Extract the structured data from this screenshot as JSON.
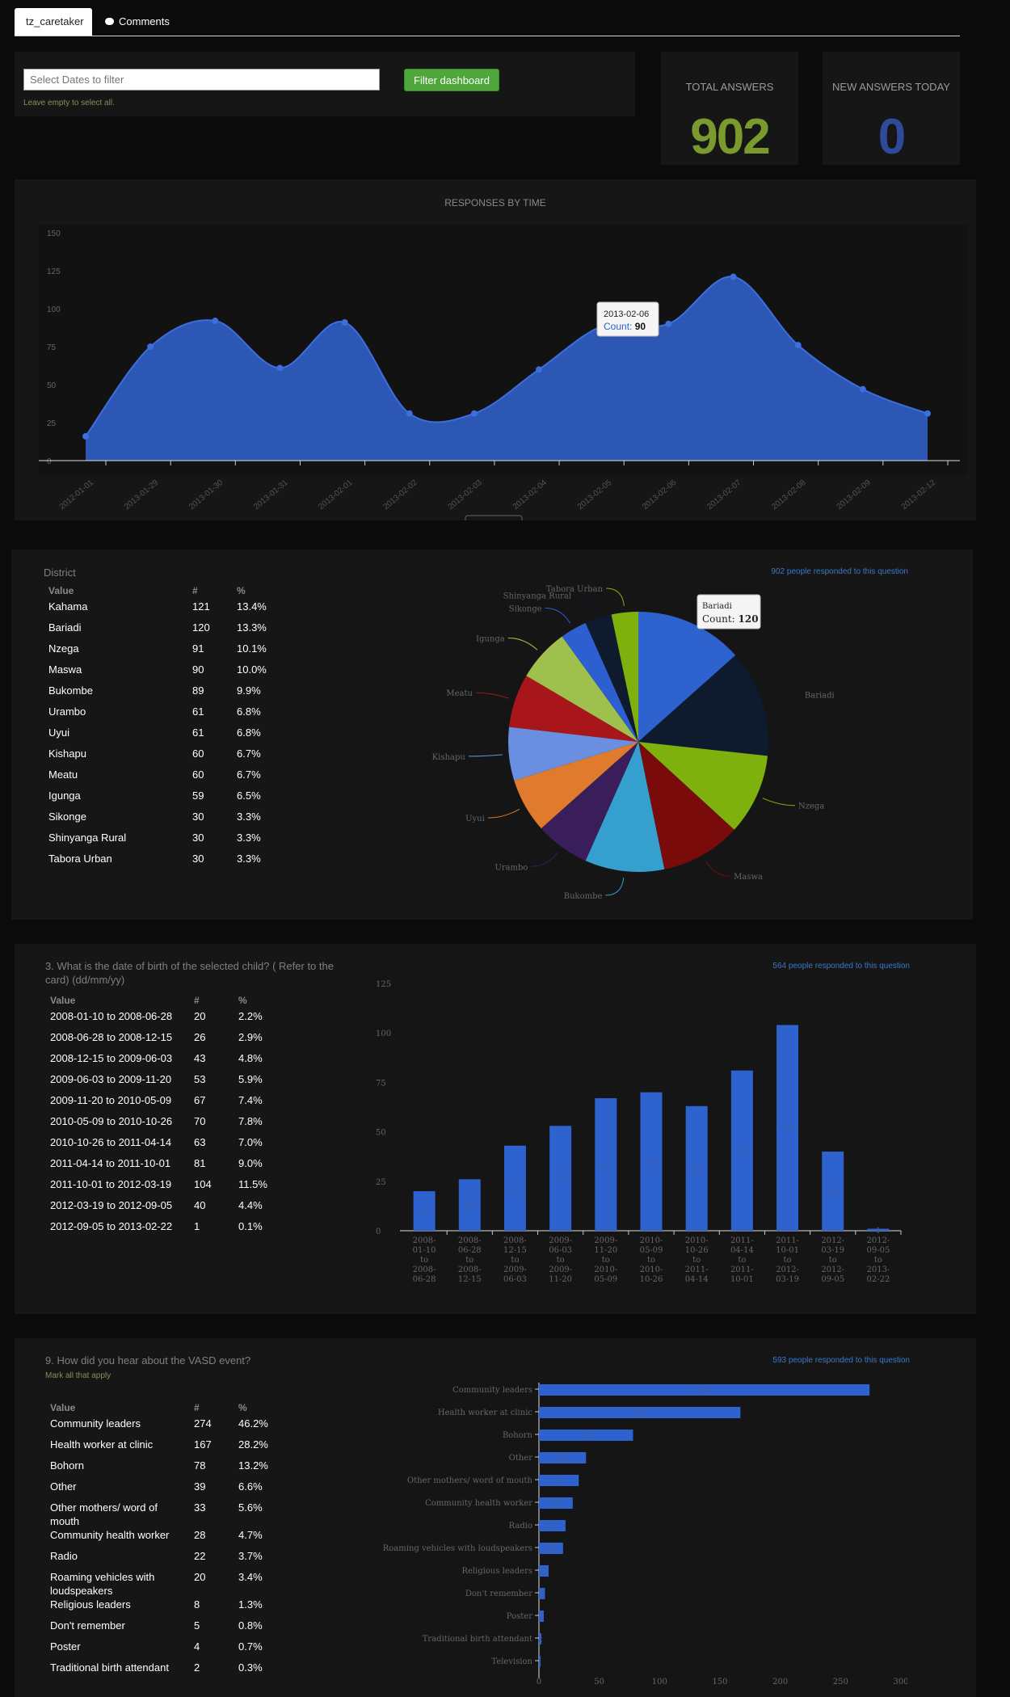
{
  "tabs": [
    {
      "label": "tz_caretaker",
      "active": true
    },
    {
      "label": "Comments",
      "active": false
    }
  ],
  "filter": {
    "placeholder": "Select Dates to filter",
    "button_label": "Filter dashboard",
    "hint": "Leave empty to select all."
  },
  "stats": [
    {
      "title": "TOTAL ANSWERS",
      "value": "902",
      "color": "#7a9a2e"
    },
    {
      "title": "NEW ANSWERS TODAY",
      "value": "0",
      "color": "#2e4a99"
    }
  ],
  "colors": {
    "accent_blue": "#2e62cf",
    "green": "#4fa63b"
  },
  "time_chart": {
    "title": "RESPONSES BY TIME",
    "tooltip": {
      "date": "2013-02-06",
      "label": "Count:",
      "value": "90"
    },
    "chart_data": {
      "type": "area",
      "x": [
        "2012-01-01",
        "2013-01-29",
        "2013-01-30",
        "2013-01-31",
        "2013-02-01",
        "2013-02-02",
        "2013-02-03",
        "2013-02-04",
        "2013-02-05",
        "2013-02-06",
        "2013-02-07",
        "2013-02-08",
        "2013-02-09",
        "2013-02-12"
      ],
      "values": [
        16,
        75,
        92,
        61,
        91,
        31,
        31,
        60,
        89,
        90,
        121,
        76,
        47,
        31
      ],
      "ylim": [
        0,
        150
      ],
      "yticks": [
        0,
        25,
        50,
        75,
        100,
        125,
        150
      ]
    }
  },
  "district": {
    "title": "District",
    "responded": "902 people responded to this question",
    "headers": [
      "Value",
      "#",
      "%"
    ],
    "rows": [
      [
        "Kahama",
        "121",
        "13.4%"
      ],
      [
        "Bariadi",
        "120",
        "13.3%"
      ],
      [
        "Nzega",
        "91",
        "10.1%"
      ],
      [
        "Maswa",
        "90",
        "10.0%"
      ],
      [
        "Bukombe",
        "89",
        "9.9%"
      ],
      [
        "Urambo",
        "61",
        "6.8%"
      ],
      [
        "Uyui",
        "61",
        "6.8%"
      ],
      [
        "Kishapu",
        "60",
        "6.7%"
      ],
      [
        "Meatu",
        "60",
        "6.7%"
      ],
      [
        "Igunga",
        "59",
        "6.5%"
      ],
      [
        "Sikonge",
        "30",
        "3.3%"
      ],
      [
        "Shinyanga Rural",
        "30",
        "3.3%"
      ],
      [
        "Tabora Urban",
        "30",
        "3.3%"
      ]
    ],
    "tooltip": {
      "name": "Bariadi",
      "label": "Count:",
      "value": "120"
    },
    "chart_data": {
      "type": "pie",
      "labels": [
        "Kahama",
        "Bariadi",
        "Nzega",
        "Maswa",
        "Bukombe",
        "Urambo",
        "Uyui",
        "Kishapu",
        "Meatu",
        "Igunga",
        "Sikonge",
        "Shinyanga Rural",
        "Tabora Urban"
      ],
      "values": [
        121,
        120,
        91,
        90,
        89,
        61,
        61,
        60,
        60,
        59,
        30,
        30,
        30
      ],
      "colors": [
        "#2e62cf",
        "#0e1a2e",
        "#7eb10d",
        "#7a0b0b",
        "#35a0cd",
        "#3a1e5c",
        "#e07a2c",
        "#6b8fe0",
        "#a8161c",
        "#9fc04d",
        "#2d5fd0",
        "#0f1a2f",
        "#7eb10d"
      ]
    }
  },
  "dob": {
    "title": "3. What is the date of birth of the selected child? ( Refer to the card) (dd/mm/yy)",
    "responded": "564 people responded to this question",
    "headers": [
      "Value",
      "#",
      "%"
    ],
    "rows": [
      [
        "2008-01-10 to 2008-06-28",
        "20",
        "2.2%"
      ],
      [
        "2008-06-28 to 2008-12-15",
        "26",
        "2.9%"
      ],
      [
        "2008-12-15 to 2009-06-03",
        "43",
        "4.8%"
      ],
      [
        "2009-06-03 to 2009-11-20",
        "53",
        "5.9%"
      ],
      [
        "2009-11-20 to 2010-05-09",
        "67",
        "7.4%"
      ],
      [
        "2010-05-09 to 2010-10-26",
        "70",
        "7.8%"
      ],
      [
        "2010-10-26 to 2011-04-14",
        "63",
        "7.0%"
      ],
      [
        "2011-04-14 to 2011-10-01",
        "81",
        "9.0%"
      ],
      [
        "2011-10-01 to 2012-03-19",
        "104",
        "11.5%"
      ],
      [
        "2012-03-19 to 2012-09-05",
        "40",
        "4.4%"
      ],
      [
        "2012-09-05 to 2013-02-22",
        "1",
        "0.1%"
      ]
    ],
    "chart_data": {
      "type": "bar",
      "categories": [
        [
          "2008-",
          "01-10",
          "to",
          "2008-",
          "06-28"
        ],
        [
          "2008-",
          "06-28",
          "to",
          "2008-",
          "12-15"
        ],
        [
          "2008-",
          "12-15",
          "to",
          "2009-",
          "06-03"
        ],
        [
          "2009-",
          "06-03",
          "to",
          "2009-",
          "11-20"
        ],
        [
          "2009-",
          "11-20",
          "to",
          "2010-",
          "05-09"
        ],
        [
          "2010-",
          "05-09",
          "to",
          "2010-",
          "10-26"
        ],
        [
          "2010-",
          "10-26",
          "to",
          "2011-",
          "04-14"
        ],
        [
          "2011-",
          "04-14",
          "to",
          "2011-",
          "10-01"
        ],
        [
          "2011-",
          "10-01",
          "to",
          "2012-",
          "03-19"
        ],
        [
          "2012-",
          "03-19",
          "to",
          "2012-",
          "09-05"
        ],
        [
          "2012-",
          "09-05",
          "to",
          "2013-",
          "02-22"
        ]
      ],
      "values": [
        20,
        26,
        43,
        53,
        67,
        70,
        63,
        81,
        104,
        40,
        1
      ],
      "ylim": [
        0,
        125
      ],
      "yticks": [
        0,
        25,
        50,
        75,
        100,
        125
      ]
    }
  },
  "hear": {
    "title": "9. How did you hear about the VASD event?",
    "subtitle": "Mark all that apply",
    "responded": "593 people responded to this question",
    "headers": [
      "Value",
      "#",
      "%"
    ],
    "rows": [
      [
        "Community leaders",
        "274",
        "46.2%"
      ],
      [
        "Health worker at clinic",
        "167",
        "28.2%"
      ],
      [
        "Bohorn",
        "78",
        "13.2%"
      ],
      [
        "Other",
        "39",
        "6.6%"
      ],
      [
        "Other mothers/ word of mouth",
        "33",
        "5.6%"
      ],
      [
        "Community health worker",
        "28",
        "4.7%"
      ],
      [
        "Radio",
        "22",
        "3.7%"
      ],
      [
        "Roaming vehicles with loudspeakers",
        "20",
        "3.4%"
      ],
      [
        "Religious leaders",
        "8",
        "1.3%"
      ],
      [
        "Don't remember",
        "5",
        "0.8%"
      ],
      [
        "Poster",
        "4",
        "0.7%"
      ],
      [
        "Traditional birth attendant",
        "2",
        "0.3%"
      ]
    ],
    "chart_data": {
      "type": "bar",
      "orientation": "horizontal",
      "categories": [
        "Community leaders",
        "Health worker at clinic",
        "Bohorn",
        "Other",
        "Other mothers/ word of mouth",
        "Community health worker",
        "Radio",
        "Roaming vehicles with loudspeakers",
        "Religious leaders",
        "Don't remember",
        "Poster",
        "Traditional birth attendant",
        "Television"
      ],
      "values": [
        274,
        167,
        78,
        39,
        33,
        28,
        22,
        20,
        8,
        5,
        4,
        2,
        1
      ],
      "xlim": [
        0,
        300
      ],
      "xticks": [
        0,
        50,
        100,
        150,
        200,
        250,
        300
      ]
    }
  }
}
